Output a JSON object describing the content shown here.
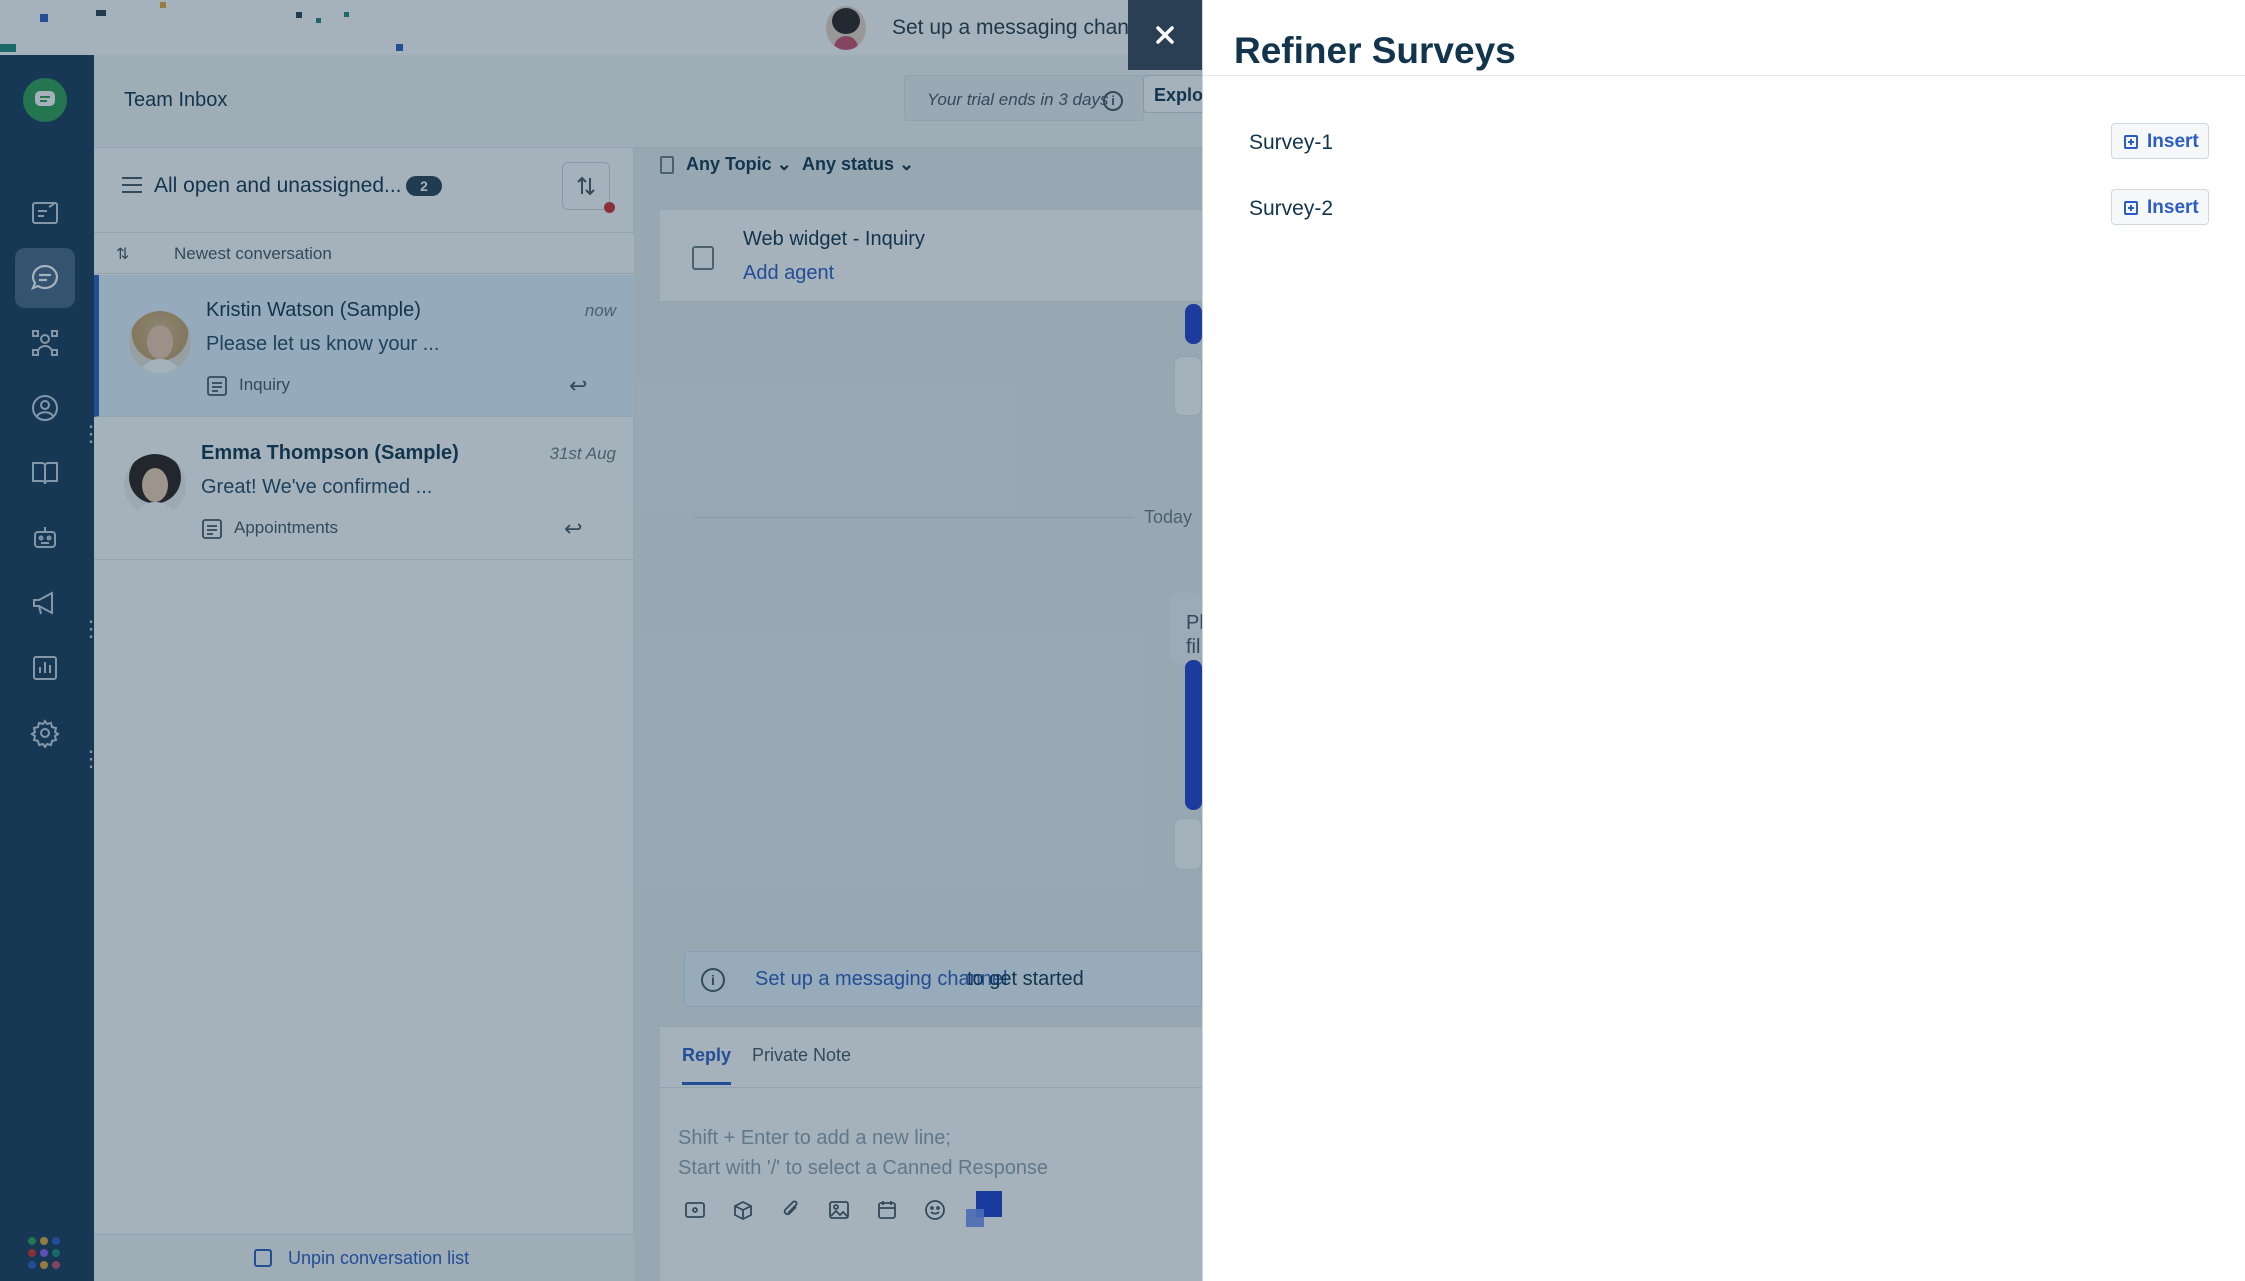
{
  "banner": {
    "text": "Set up a messaging channel to get started"
  },
  "nav": {
    "items": [
      {
        "icon": "tickets-icon"
      },
      {
        "icon": "conversations-icon",
        "active": true
      },
      {
        "icon": "contacts-flow-icon"
      },
      {
        "icon": "contacts-icon"
      },
      {
        "icon": "knowledge-base-icon"
      },
      {
        "icon": "bot-icon"
      },
      {
        "icon": "campaigns-icon"
      },
      {
        "icon": "analytics-icon"
      },
      {
        "icon": "settings-icon"
      }
    ]
  },
  "header": {
    "title": "Team Inbox",
    "trial_text": "Your trial ends in 3 days",
    "explore_label": "Explore"
  },
  "list": {
    "filter_label": "All open and unassigned...",
    "count": "2",
    "sort_label": "Newest conversation",
    "conversations": [
      {
        "name": "Kristin Watson (Sample)",
        "time": "now",
        "preview": "Please let us know your ...",
        "tag": "Inquiry"
      },
      {
        "name": "Emma Thompson (Sample)",
        "time": "31st Aug",
        "preview": "Great! We've confirmed ...",
        "tag": "Appointments"
      }
    ],
    "unpin_label": "Unpin conversation list"
  },
  "detail": {
    "topic_filter": "Any Topic",
    "status_filter": "Any status",
    "thread_title": "Web widget - Inquiry",
    "add_agent": "Add agent",
    "day_separator": "Today",
    "bubble_text": "Pl\nfil",
    "note_link": "Set up a messaging channel",
    "note_rest": "to get started",
    "reply_tab": "Reply",
    "note_tab": "Private Note",
    "placeholder_line1": "Shift + Enter to add a new line;",
    "placeholder_line2": "Start with '/' to select a Canned Response"
  },
  "drawer": {
    "title": "Refiner Surveys",
    "surveys": [
      {
        "name": "Survey-1",
        "action": "Insert"
      },
      {
        "name": "Survey-2",
        "action": "Insert"
      }
    ]
  },
  "colors": {
    "nav_bg": "#1b3a5a",
    "accent": "#2c5cc5",
    "overlay": "rgba(18,52,77,0.38)"
  }
}
